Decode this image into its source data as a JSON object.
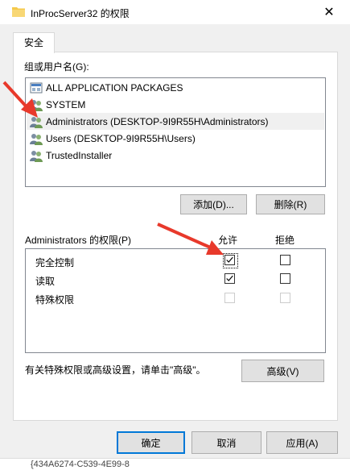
{
  "window": {
    "title": "InProcServer32 的权限",
    "close_glyph": "✕"
  },
  "tabs": [
    {
      "label": "安全"
    }
  ],
  "groups": {
    "label": "组或用户名(G):",
    "items": [
      {
        "name": "ALL APPLICATION PACKAGES",
        "icon": "package-group-icon"
      },
      {
        "name": "SYSTEM",
        "icon": "users-group-icon"
      },
      {
        "name": "Administrators (DESKTOP-9I9R55H\\Administrators)",
        "icon": "users-group-icon"
      },
      {
        "name": "Users (DESKTOP-9I9R55H\\Users)",
        "icon": "users-group-icon"
      },
      {
        "name": "TrustedInstaller",
        "icon": "users-group-icon"
      }
    ],
    "selected_index": 2,
    "add_button": "添加(D)...",
    "remove_button": "删除(R)"
  },
  "permissions": {
    "label": "Administrators 的权限(P)",
    "allow_header": "允许",
    "deny_header": "拒绝",
    "rows": [
      {
        "name": "完全控制",
        "allow": true,
        "deny": false,
        "disabled": false
      },
      {
        "name": "读取",
        "allow": true,
        "deny": false,
        "disabled": false
      },
      {
        "name": "特殊权限",
        "allow": false,
        "deny": false,
        "disabled": true
      }
    ]
  },
  "advanced": {
    "info": "有关特殊权限或高级设置，请单击\"高级\"。",
    "button": "高级(V)"
  },
  "footer": {
    "ok": "确定",
    "cancel": "取消",
    "apply": "应用(A)"
  },
  "background_window": {
    "text": "{434A6274-C539-4E99-8"
  },
  "colors": {
    "annotation_arrow": "#e8392b",
    "accent_border": "#0078d7",
    "folder": "#f5c94a"
  }
}
